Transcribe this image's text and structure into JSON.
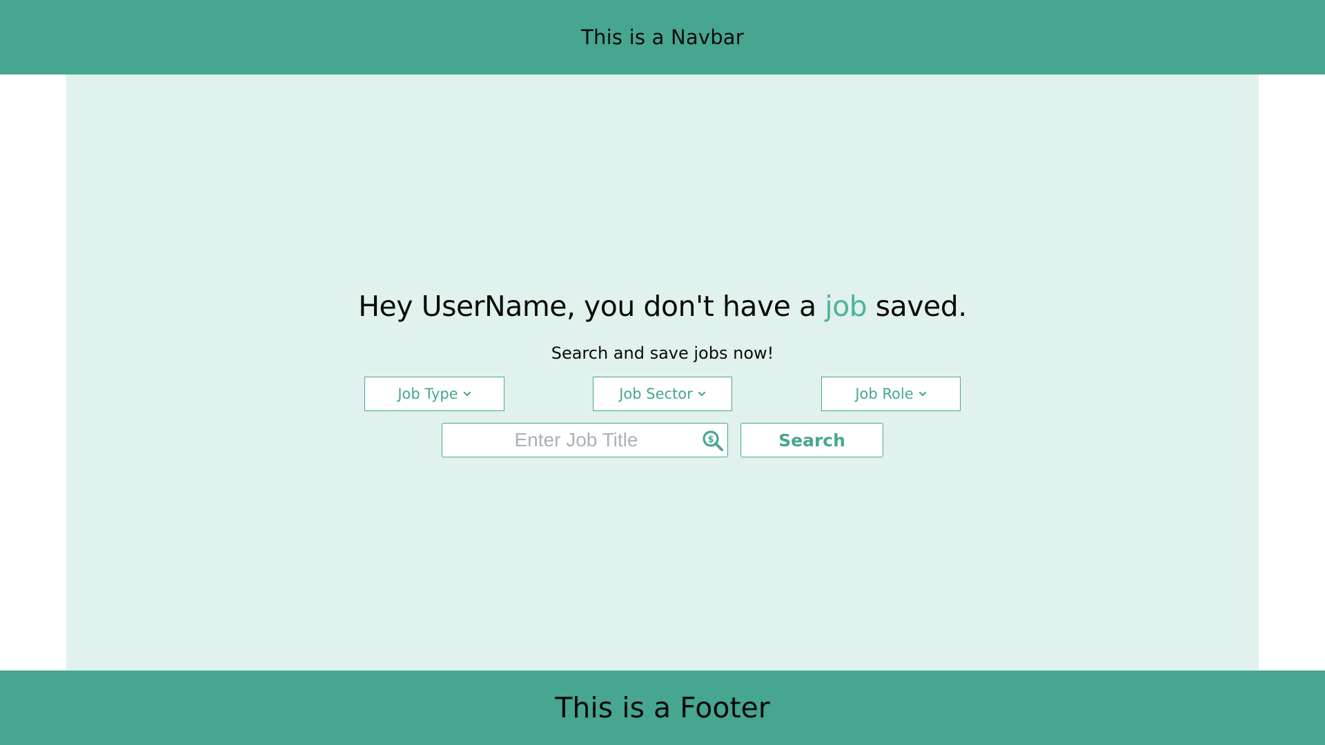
{
  "navbar": {
    "title": "This is a Navbar"
  },
  "main": {
    "headline": {
      "prefix": "Hey UserName, you don't have a ",
      "accent": "job",
      "suffix": " saved."
    },
    "subline": "Search and save jobs now!",
    "filters": [
      {
        "label": "Job Type",
        "icon": "chevron-down-icon"
      },
      {
        "label": "Job Sector",
        "icon": "chevron-down-icon"
      },
      {
        "label": "Job Role",
        "icon": "chevron-down-icon"
      }
    ],
    "search": {
      "placeholder": "Enter Job Title",
      "value": "",
      "icon": "search-dollar-icon",
      "button_label": "Search"
    }
  },
  "footer": {
    "title": "This is a Footer"
  },
  "colors": {
    "brand": "#46a690",
    "accent": "#4fb39d",
    "main_background": "#e1f1ed",
    "text": "#0a0a0a"
  }
}
